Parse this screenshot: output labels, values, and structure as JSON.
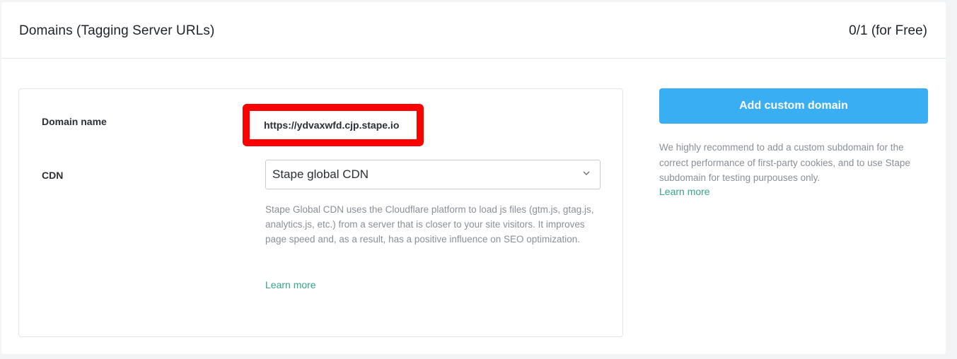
{
  "header": {
    "title": "Domains (Tagging Server URLs)",
    "plan_count": "0/1 (for Free)"
  },
  "domain": {
    "label": "Domain name",
    "value": "https://ydvaxwfd.cjp.stape.io",
    "highlight_color": "#ff0000"
  },
  "cdn": {
    "label": "CDN",
    "selected": "Stape global CDN",
    "help_text": "Stape Global CDN uses the Cloudflare platform to load js files (gtm.js, gtag.js, analytics.js, etc.) from a server that is closer to your site visitors. It improves page speed and, as a result, has a positive influence on SEO optimization.",
    "learn_more": "Learn more",
    "chevron_icon": "chevron-down-icon"
  },
  "sidebar": {
    "add_button": "Add custom domain",
    "recommendation": "We highly recommend to add a custom subdomain for the correct performance of first-party cookies, and to use Stape subdomain for testing purpouses only.",
    "learn_more": "Learn more"
  },
  "colors": {
    "accent_button": "#3aaef2",
    "link": "#35a38a"
  }
}
